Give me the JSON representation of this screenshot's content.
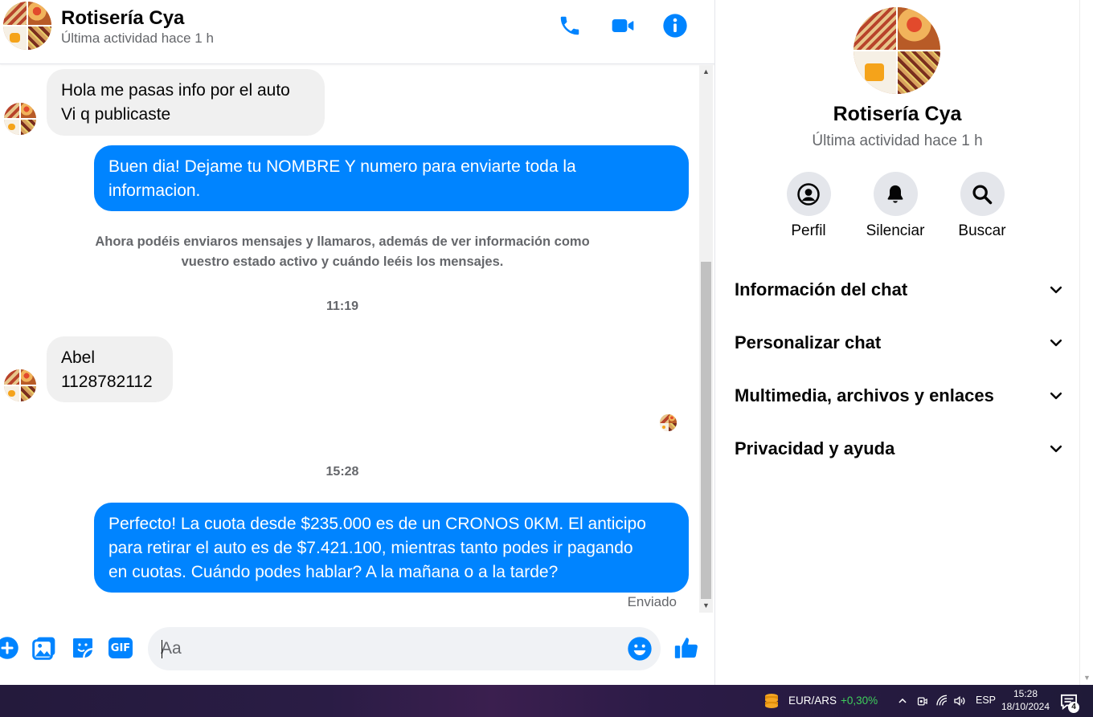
{
  "contact": {
    "name": "Rotisería Cya",
    "status": "Última actividad hace 1 h"
  },
  "header": {
    "icons": [
      "phone-icon",
      "video-camera-icon",
      "info-icon"
    ]
  },
  "messages": [
    {
      "type": "incoming",
      "lines": [
        "Hola me pasas info por el auto",
        "Vi q publicaste"
      ]
    },
    {
      "type": "outgoing",
      "lines": [
        "Buen dia! Dejame tu NOMBRE Y numero para enviarte toda la",
        "informacion."
      ]
    },
    {
      "type": "system",
      "lines": [
        "Ahora podéis enviaros mensajes y llamaros, además de ver información como",
        "vuestro estado activo y cuándo leéis los mensajes."
      ]
    },
    {
      "type": "timestamp",
      "text": "11:19"
    },
    {
      "type": "incoming",
      "lines": [
        "Abel",
        "1128782112"
      ]
    },
    {
      "type": "timestamp",
      "text": "15:28"
    },
    {
      "type": "outgoing",
      "lines": [
        "Perfecto! La cuota desde $235.000 es de un CRONOS 0KM. El anticipo",
        "para retirar el auto es de $7.421.100, mientras tanto podes ir pagando",
        "en cuotas. Cuándo podes hablar? A la mañana o a la tarde?"
      ]
    }
  ],
  "sent_status": "Enviado",
  "composer": {
    "placeholder": "Aa",
    "icons": [
      "add-icon",
      "gallery-icon",
      "sticker-icon",
      "gif-icon",
      "emoji-icon",
      "thumbs-up-icon"
    ],
    "gif_label": "GIF"
  },
  "info_panel": {
    "actions": [
      {
        "label": "Perfil",
        "icon": "profile-icon"
      },
      {
        "label": "Silenciar",
        "icon": "bell-icon"
      },
      {
        "label": "Buscar",
        "icon": "search-icon"
      }
    ],
    "sections": [
      {
        "title": "Información del chat"
      },
      {
        "title": "Personalizar chat"
      },
      {
        "title": "Multimedia, archivos y enlaces"
      },
      {
        "title": "Privacidad y ayuda"
      }
    ]
  },
  "taskbar": {
    "ticker_pair": "EUR/ARS",
    "ticker_change": "+0,30%",
    "language": "ESP",
    "time": "15:28",
    "date": "18/10/2024",
    "notification_count": "4"
  },
  "colors": {
    "messenger_blue": "#0084ff",
    "incoming_bubble": "#f0f0f0",
    "secondary_text": "#65676b",
    "positive_change": "#3fcf5c"
  }
}
